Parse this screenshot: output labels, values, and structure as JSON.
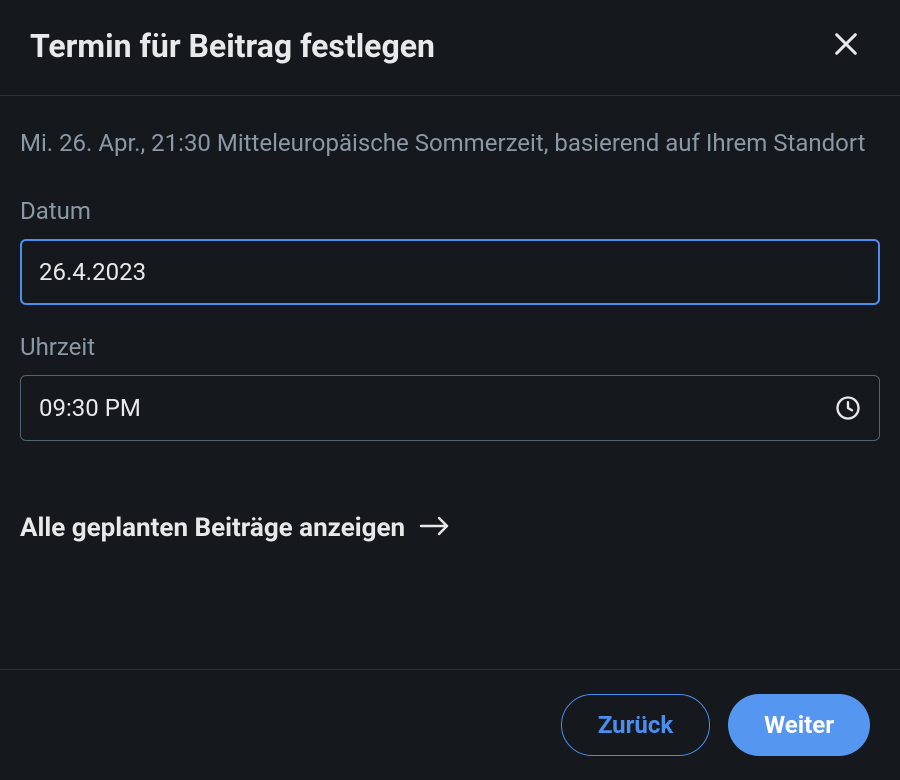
{
  "dialog": {
    "title": "Termin für Beitrag festlegen",
    "info": "Mi. 26. Apr., 21:30 Mitteleuropäische Sommerzeit, basierend auf Ihrem Standort"
  },
  "fields": {
    "date": {
      "label": "Datum",
      "value": "26.4.2023"
    },
    "time": {
      "label": "Uhrzeit",
      "value": "09:30 PM"
    }
  },
  "link": {
    "label": "Alle geplanten Beiträge anzeigen"
  },
  "footer": {
    "back": "Zurück",
    "next": "Weiter"
  }
}
